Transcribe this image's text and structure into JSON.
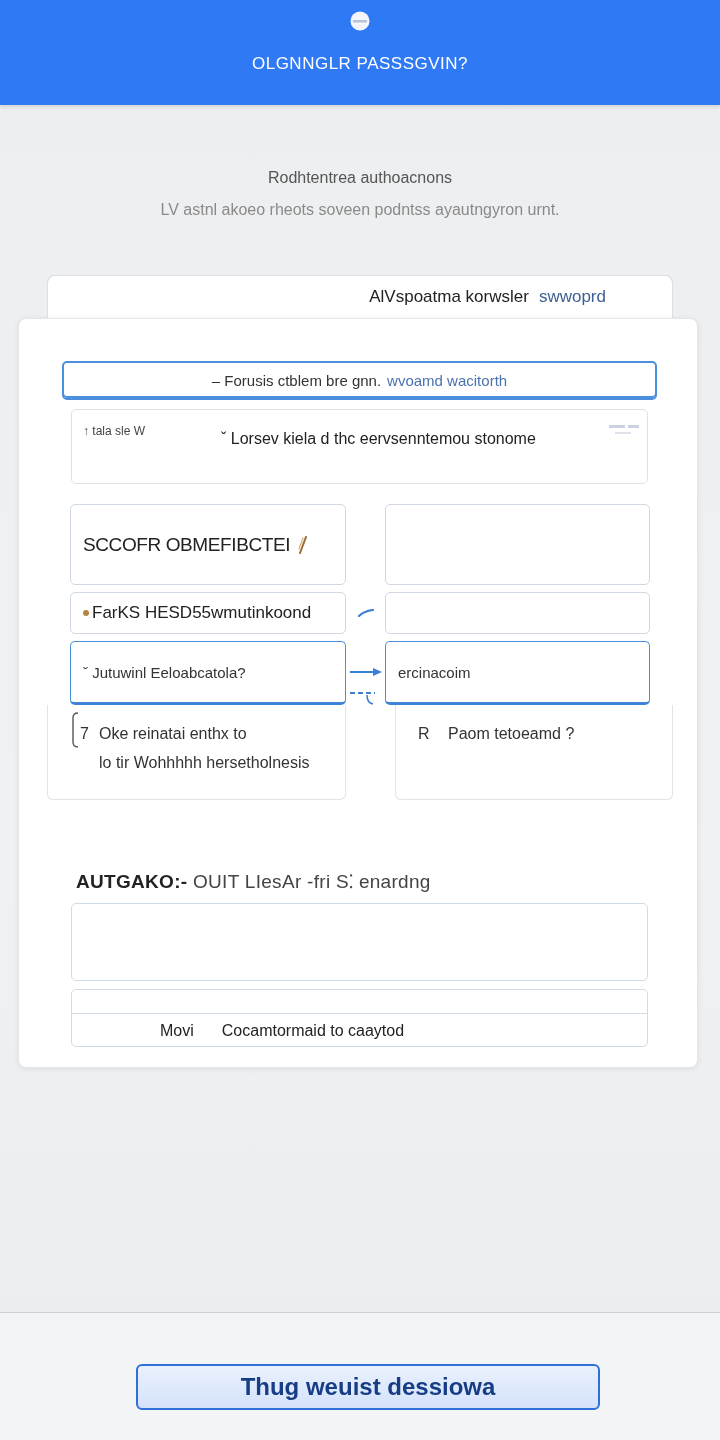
{
  "header": {
    "title": "OLGNNGLR PASSSGVIN?"
  },
  "intro": {
    "heading": "Rodhtentrea authoacnons",
    "text": "LV astnl akoeo rheots soveen podntss ayautngyron urnt."
  },
  "form": {
    "title": "AlVspoatma korwsler",
    "link": "swwoprd",
    "search_field": {
      "value": "– Forusis ctblem bre gnn.",
      "link": "wvoamd wacitorth",
      "focused": true
    },
    "note_field": {
      "label": "↑ tala sle W",
      "value": "ˇ Lorsev kiela d thc eervsenntemou stonome"
    },
    "pairs": [
      {
        "left": {
          "value": "SCCOFR OBMEFIBCTEI",
          "focused": false
        },
        "right": {
          "focused": false
        }
      },
      {
        "left": {
          "value": "FarKS HESD55wmutinkoond",
          "focused": false
        },
        "right": {
          "focused": false
        }
      },
      {
        "left": {
          "value": "ˇ Jutuwinl Eeloabcatola?",
          "focused": true
        },
        "right": {
          "value": "ercinacoim",
          "focused": true
        }
      }
    ],
    "answers": [
      {
        "marker": "7",
        "lines": [
          "Oke reinatai enthx to",
          "lo tir Wohhhhh hersetholnesis"
        ]
      },
      {
        "marker": "R",
        "lines": [
          "Paom tetoeamd ?"
        ]
      }
    ]
  },
  "section": {
    "title": "**AUTGAKO:-** OUIT LIesAr -fri S⁚ enardng",
    "table": {
      "rows": [
        {
          "cells": [
            "Movi",
            "Cocamtormaid to caaytod"
          ]
        }
      ]
    }
  },
  "footer": {
    "button": "Thug weuist dessiowa"
  }
}
